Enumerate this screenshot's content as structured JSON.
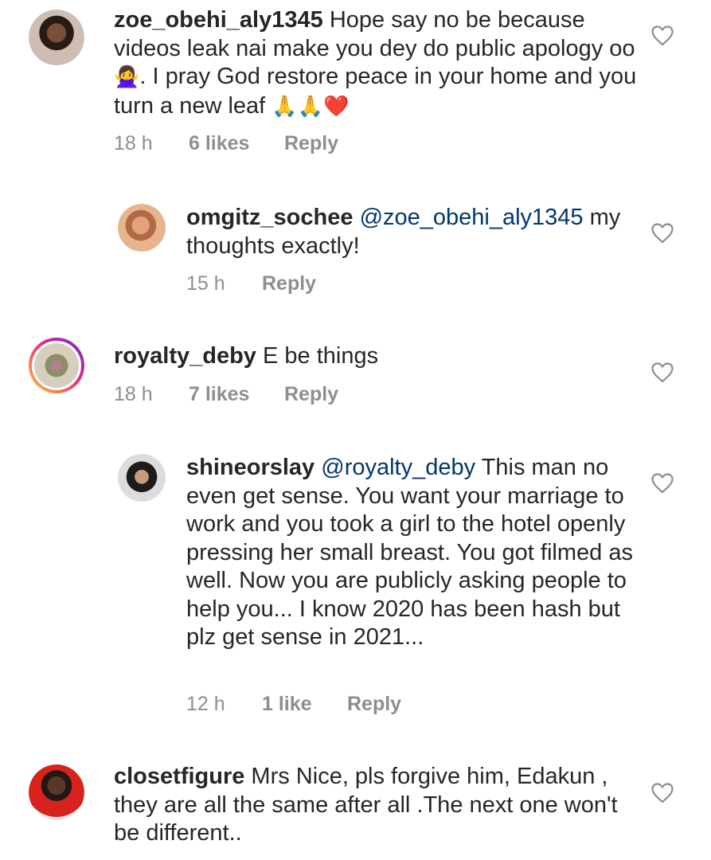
{
  "comments": [
    {
      "username": "zoe_obehi_aly1345",
      "text_before_emoji": " Hope say no be because videos leak nai make you dey do public apology oo ",
      "emoji1": "🙅‍♀️",
      "text_after_emoji": ". I pray God restore peace in your home and you turn a new leaf ",
      "emoji2": "🙏🙏❤️",
      "time": "18 h",
      "likes": "6 likes",
      "reply": "Reply",
      "avatar_icon": "profile-photo"
    },
    {
      "username": "omgitz_sochee",
      "mention": "@zoe_obehi_aly1345",
      "text": " my thoughts exactly!",
      "time": "15 h",
      "reply": "Reply",
      "avatar_icon": "profile-photo"
    },
    {
      "username": "royalty_deby",
      "text": " E be things",
      "time": "18 h",
      "likes": "7 likes",
      "reply": "Reply",
      "avatar_icon": "profile-photo-story-ring"
    },
    {
      "username": "shineorslay",
      "mention": "@royalty_deby",
      "text": " This man no even get sense.  You want your marriage to work and you took a girl to the hotel openly pressing her small breast. You got filmed as well. Now you are publicly asking people to help you... I know 2020 has been hash but plz get sense in 2021...",
      "time": "12 h",
      "likes": "1 like",
      "reply": "Reply",
      "avatar_icon": "profile-photo"
    },
    {
      "username": "closetfigure",
      "text": " Mrs Nice, pls forgive him, Edakun , they are all the same after all .The next one won't be different..",
      "avatar_icon": "profile-photo"
    }
  ],
  "icons": {
    "like": "heart-outline-icon"
  },
  "colors": {
    "text": "#262626",
    "meta": "#8e8e8e",
    "mention": "#00376b",
    "heart": "#8e8e8e"
  }
}
